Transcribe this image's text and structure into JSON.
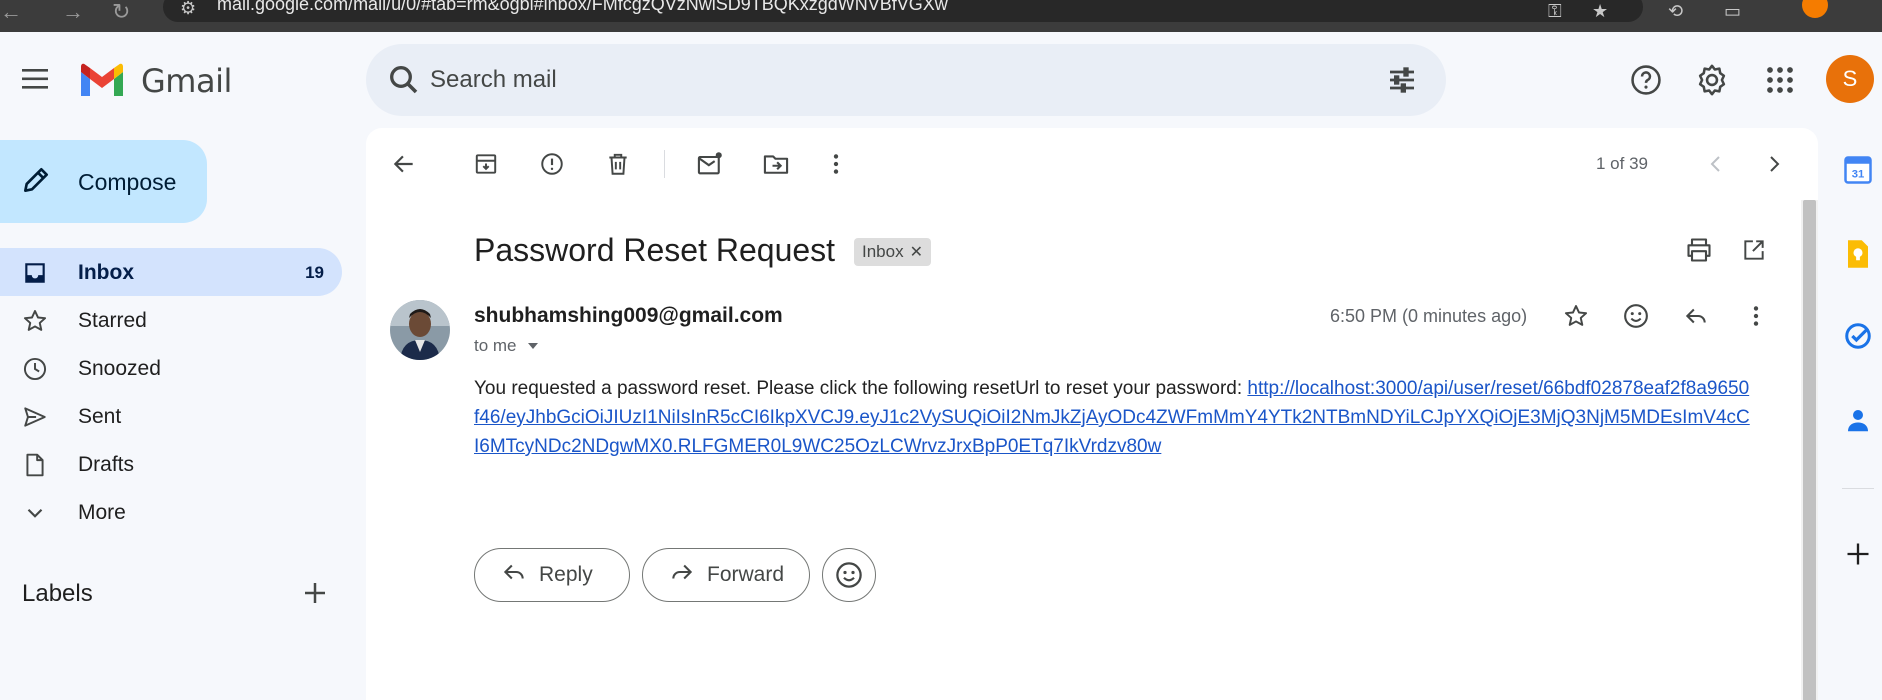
{
  "browser": {
    "url": "mail.google.com/mail/u/0/#tab=rm&ogbl#inbox/FMfcgzQVzNwlSD9TBQKxzgdWNVBfVGXw"
  },
  "app": {
    "name": "Gmail"
  },
  "search": {
    "placeholder": "Search mail"
  },
  "account": {
    "initial": "S"
  },
  "sidebar": {
    "compose_label": "Compose",
    "items": [
      {
        "label": "Inbox",
        "count": "19"
      },
      {
        "label": "Starred"
      },
      {
        "label": "Snoozed"
      },
      {
        "label": "Sent"
      },
      {
        "label": "Drafts"
      },
      {
        "label": "More"
      }
    ],
    "labels_heading": "Labels"
  },
  "toolbar": {
    "pager": "1 of 39"
  },
  "email": {
    "subject": "Password Reset Request",
    "label_chip": "Inbox",
    "sender": "shubhamshing009@gmail.com",
    "recipient": "to me",
    "time": "6:50 PM (0 minutes ago)",
    "body_text": "You requested a password reset. Please click the following resetUrl to reset your password: ",
    "link": "http://localhost:3000/api/user/reset/66bdf02878eaf2f8a9650f46/eyJhbGciOiJIUzI1NiIsInR5cCI6IkpXVCJ9.eyJ1c2VySUQiOiI2NmJkZjAyODc4ZWFmMmY4YTk2NTBmNDYiLCJpYXQiOjE3MjQ3NjM5MDEsImV4cCI6MTcyNDc2NDgwMX0.RLFGMER0L9WC25OzLCWrvzJrxBpP0ETq7IkVrdzv80w"
  },
  "actions": {
    "reply": "Reply",
    "forward": "Forward"
  },
  "colors": {
    "accent": "#c2e7ff",
    "active_nav": "#d3e3fd",
    "link": "#1a55c8",
    "avatar": "#e8710a"
  }
}
